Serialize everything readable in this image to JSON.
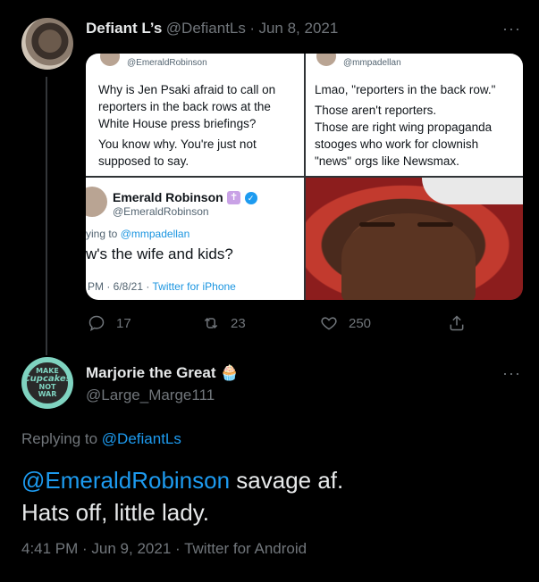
{
  "parent_tweet": {
    "display_name": "Defiant L’s",
    "handle": "@DefiantLs",
    "date": "Jun 8, 2021",
    "media": {
      "cell1": {
        "handle": "@EmeraldRobinson",
        "para1": "Why is Jen Psaki afraid to call on reporters in the back rows at the White House press briefings?",
        "para2": "You know why. You're just not supposed to say."
      },
      "cell2": {
        "handle": "@mmpadellan",
        "para1": "Lmao, \"reporters in the back row.\"",
        "para2": "Those aren't reporters.",
        "para3": "Those are right wing propaganda stooges who work for clownish \"news\" orgs like Newsmax."
      },
      "cell3": {
        "name": "Emerald Robinson",
        "handle": "@EmeraldRobinson",
        "replying_prefix": "ying to",
        "replying_to": "@mmpadellan",
        "text": "w's the wife and kids?",
        "time_prefix": "PM · 6/8/21 ·",
        "source": "Twitter for iPhone"
      }
    },
    "actions": {
      "reply_count": "17",
      "retweet_count": "23",
      "like_count": "250"
    }
  },
  "reply_tweet": {
    "display_name": "Marjorie the Great",
    "emoji": "🧁",
    "handle": "@Large_Marge111",
    "replying_label": "Replying to",
    "replying_handle": "@DefiantLs",
    "mention": "@EmeraldRobinson",
    "text_after_mention": " savage af.",
    "line2": "Hats off, little lady.",
    "time": "4:41 PM · Jun 9, 2021 · Twitter for Android"
  },
  "more_icon": "···",
  "avatar_badge": {
    "line1": "MAKE",
    "line2": "Cupcakes",
    "line3": "NOT",
    "line4": "WAR"
  }
}
